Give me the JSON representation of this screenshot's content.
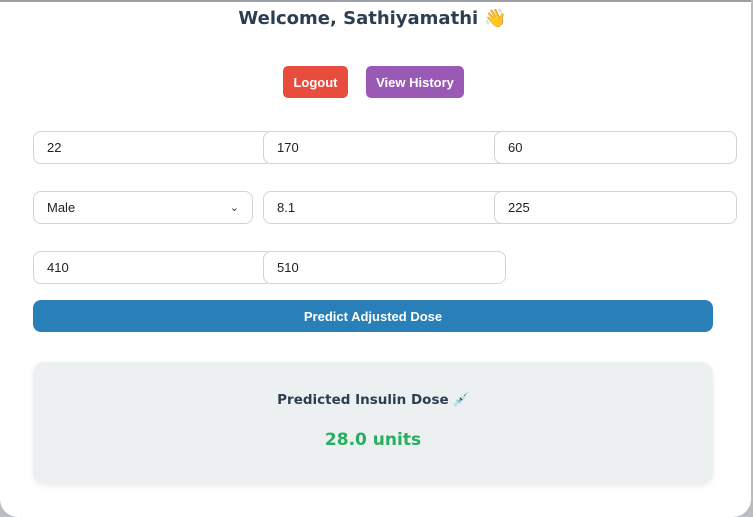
{
  "header": {
    "welcome_text": "Welcome, Sathiyamathi",
    "wave_emoji": "👋"
  },
  "buttons": {
    "logout_label": "Logout",
    "history_label": "View History"
  },
  "form": {
    "row1": [
      "22",
      "170",
      "60"
    ],
    "gender_selected": "Male",
    "row2": [
      "8.1",
      "225"
    ],
    "row3": [
      "410",
      "510"
    ],
    "predict_label": "Predict Adjusted Dose"
  },
  "result": {
    "label": "Predicted Insulin Dose",
    "syringe_emoji": "💉",
    "value": "28.0 units"
  },
  "colors": {
    "logout": "#e74c3c",
    "history": "#9b59b6",
    "predict": "#2980b9",
    "result_value": "#27ae60"
  }
}
